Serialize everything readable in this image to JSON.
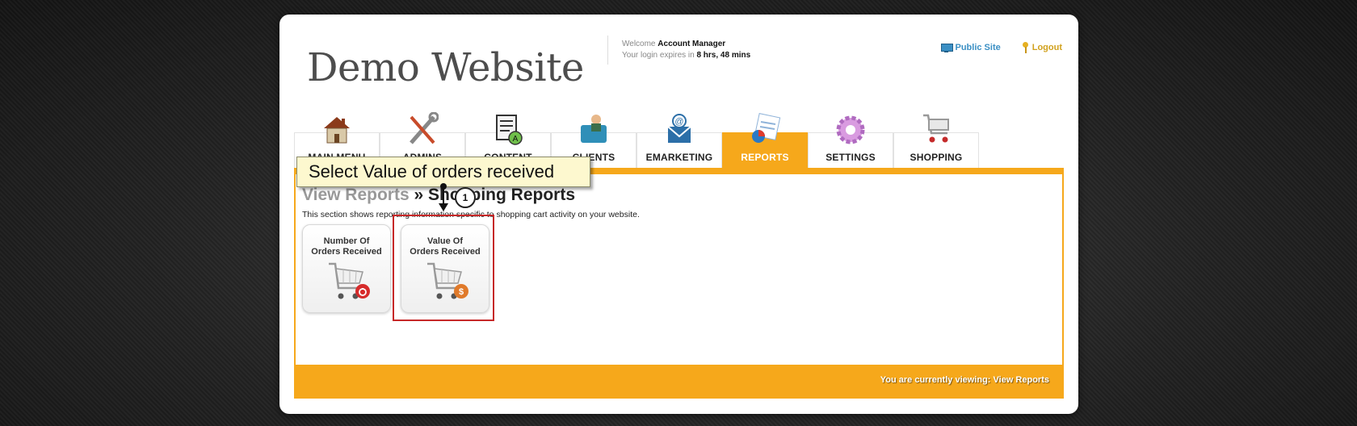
{
  "site": {
    "title": "Demo Website"
  },
  "session": {
    "welcome_prefix": "Welcome",
    "user": "Account Manager",
    "expires_prefix": "Your login expires in",
    "expires_value": "8 hrs, 48 mins"
  },
  "toplinks": {
    "public_site": "Public Site",
    "logout": "Logout"
  },
  "tabs": [
    {
      "label": "MAIN MENU",
      "icon": "house-icon"
    },
    {
      "label": "ADMINS",
      "icon": "tools-icon"
    },
    {
      "label": "CONTENT",
      "icon": "content-icon"
    },
    {
      "label": "CLIENTS",
      "icon": "clients-icon"
    },
    {
      "label": "EMARKETING",
      "icon": "email-icon"
    },
    {
      "label": "REPORTS",
      "icon": "reports-icon",
      "active": true
    },
    {
      "label": "SETTINGS",
      "icon": "gear-icon"
    },
    {
      "label": "SHOPPING",
      "icon": "cart-icon"
    }
  ],
  "main": {
    "breadcrumb_link": "View Reports",
    "breadcrumb_sep": " » ",
    "breadcrumb_current": "Shopping Reports",
    "description": "This section shows reporting information specific to shopping cart activity on your website.",
    "tiles": [
      {
        "line1": "Number Of",
        "line2": "Orders Received",
        "badge_color": "#d62b2b"
      },
      {
        "line1": "Value Of",
        "line2": "Orders Received",
        "badge_color": "#e07a2a"
      }
    ],
    "footer": "You are currently viewing: View Reports"
  },
  "annotation": {
    "callout": "Select Value of orders received",
    "step": "1"
  },
  "colors": {
    "accent": "#f6a81b",
    "highlight": "#c62828"
  }
}
